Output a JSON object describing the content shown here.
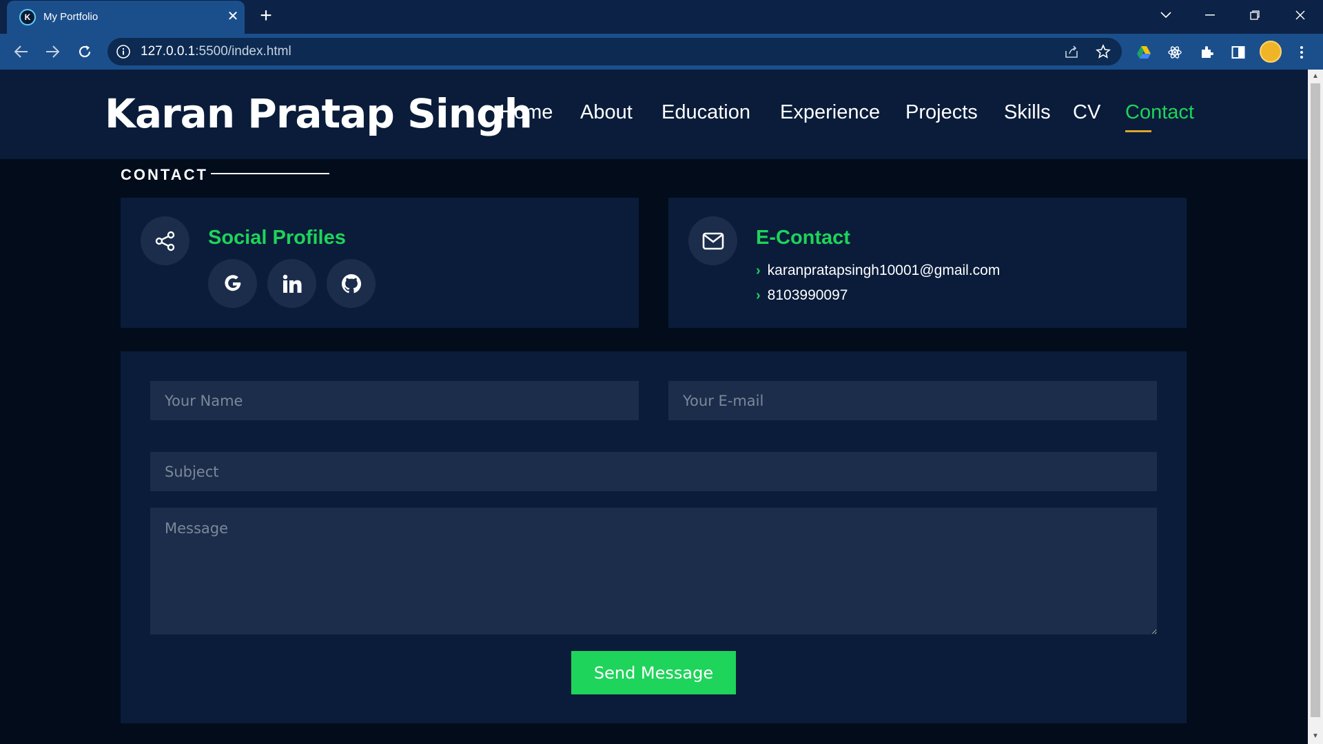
{
  "browser": {
    "tab_title": "My Portfolio",
    "favicon_letter": "K",
    "url_host": "127.0.0.1",
    "url_rest": ":5500/index.html"
  },
  "site": {
    "brand": "Karan Pratap Singh",
    "nav": [
      "Home",
      "About",
      "Education",
      "Experience",
      "Projects",
      "Skills",
      "CV",
      "Contact"
    ],
    "active_nav": "Contact",
    "accent_color": "#1ed45a",
    "underline_color": "#e0a52c"
  },
  "contact": {
    "section_title": "CONTACT",
    "social": {
      "title": "Social Profiles",
      "icon": "share-icon",
      "profiles": [
        "google-icon",
        "linkedin-icon",
        "github-icon"
      ]
    },
    "econtact": {
      "title": "E-Contact",
      "icon": "mail-icon",
      "email": "karanpratapsingh10001@gmail.com",
      "phone": "8103990097"
    },
    "form": {
      "name_placeholder": "Your Name",
      "email_placeholder": "Your E-mail",
      "subject_placeholder": "Subject",
      "message_placeholder": "Message",
      "submit_label": "Send Message"
    }
  }
}
